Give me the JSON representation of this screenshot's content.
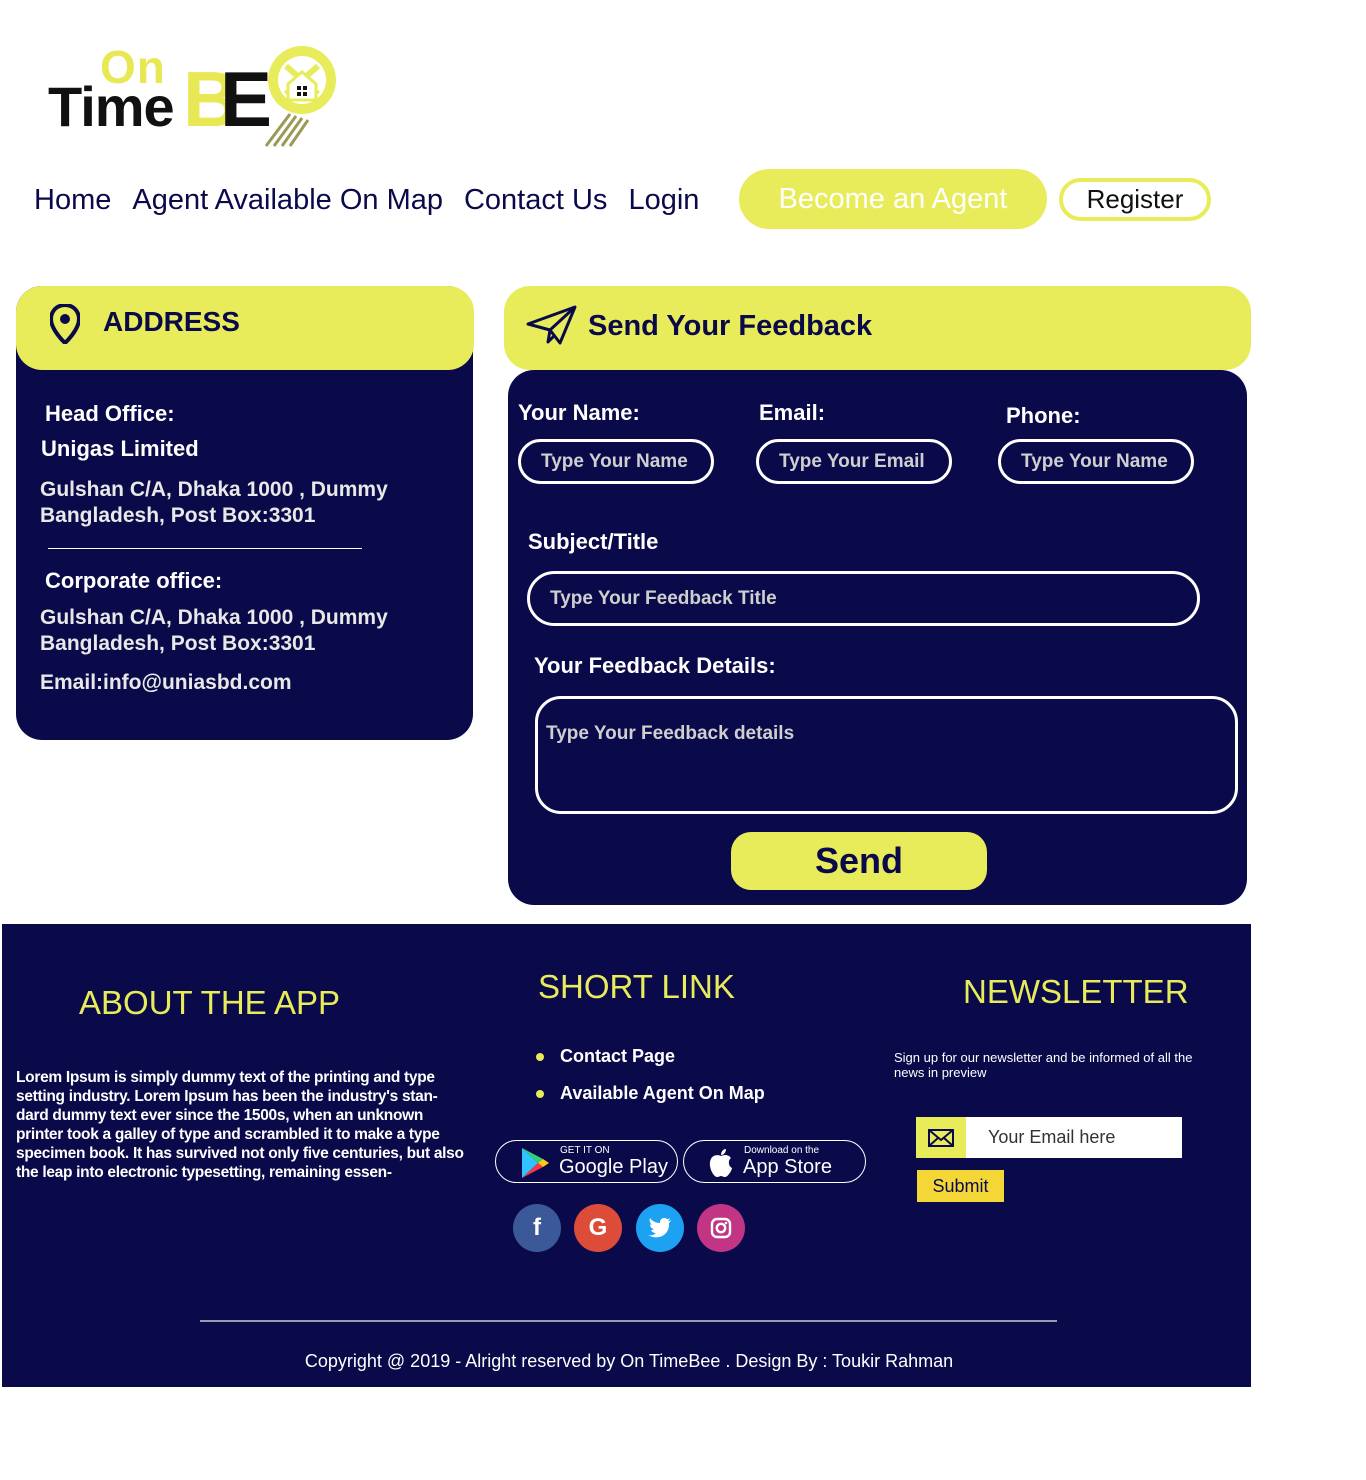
{
  "logo": {
    "on": "On",
    "time": "Time",
    "b": "B",
    "e": "E"
  },
  "nav": {
    "items": [
      "Home",
      "Agent Available On Map",
      "Contact Us",
      "Login"
    ],
    "become_agent": "Become an Agent",
    "register": "Register"
  },
  "address": {
    "title": "ADDRESS",
    "head_office_label": "Head Office:",
    "company": "Unigas Limited",
    "head_office_line1": "Gulshan C/A, Dhaka 1000 , Dummy",
    "head_office_line2": "Bangladesh, Post Box:3301",
    "corporate_label": "Corporate office:",
    "corporate_line1": "Gulshan C/A, Dhaka 1000 , Dummy",
    "corporate_line2": "Bangladesh, Post Box:3301",
    "email": "Email:info@uniasbd.com"
  },
  "feedback": {
    "title": "Send Your Feedback",
    "name_label": "Your Name:",
    "name_placeholder": "Type Your Name",
    "email_label": "Email:",
    "email_placeholder": "Type Your Email",
    "phone_label": "Phone:",
    "phone_placeholder": "Type Your Name",
    "subject_label": "Subject/Title",
    "subject_placeholder": "Type Your Feedback Title",
    "details_label": "Your Feedback Details:",
    "details_placeholder": "Type Your Feedback details",
    "send": "Send"
  },
  "footer": {
    "about_title": "ABOUT THE APP",
    "about_text": "Lorem Ipsum is simply dummy text of the printing and type setting industry. Lorem Ipsum has been the industry's stan-dard dummy text ever since the 1500s, when an unknown printer took a galley of type and scrambled it to make a type specimen book. It has survived not only five centuries, but also the leap into electronic typesetting, remaining essen-",
    "short_link_title": "SHORT LINK",
    "links": [
      "Contact Page",
      "Available Agent On Map"
    ],
    "google_small": "GET IT ON",
    "google_big": "Google Play",
    "apple_small": "Download on the",
    "apple_big": "App Store",
    "social": {
      "facebook": "f",
      "google": "G"
    },
    "newsletter_title": "NEWSLETTER",
    "newsletter_text": "Sign up for our newsletter and be informed of all the news in preview",
    "newsletter_placeholder": "Your Email here",
    "submit": "Submit",
    "copyright": "Copyright @ 2019 - Alright reserved by On TimeBee . Design By : Toukir Rahman"
  },
  "colors": {
    "navy": "#0a0a4a",
    "yellow": "#e8ec5a",
    "facebook": "#3b5998",
    "google": "#dd4b39",
    "twitter": "#1da1f2",
    "instagram": "#c13584"
  }
}
